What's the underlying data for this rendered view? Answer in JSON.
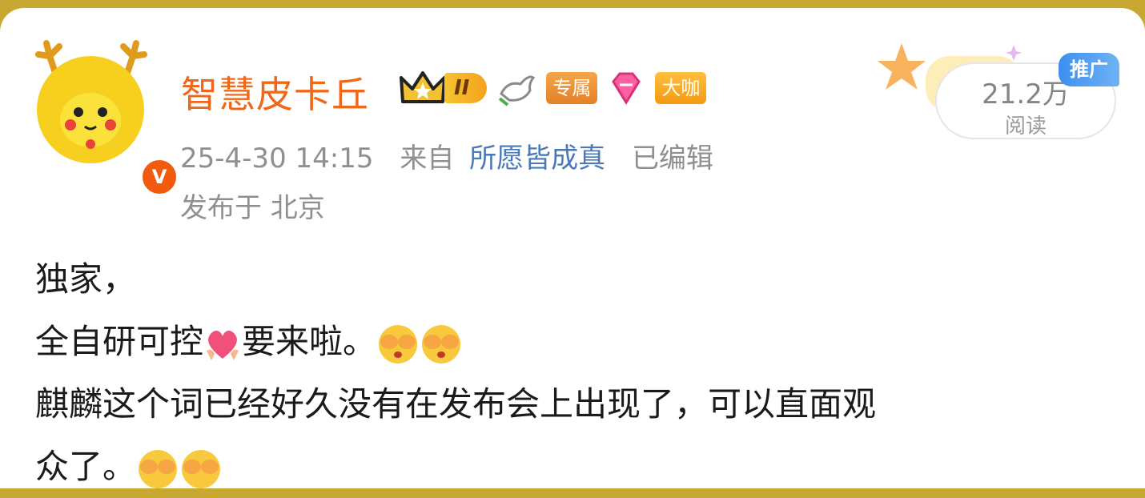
{
  "post": {
    "author": "智慧皮卡丘",
    "badges": {
      "level": "II",
      "exclusive": "专属",
      "vip": "大咖"
    },
    "time": "25-4-30 14:15",
    "from_label": "来自",
    "source": "所愿皆成真",
    "edited": "已编辑",
    "location": "发布于 北京",
    "reads_count": "21.2万",
    "reads_label": "阅读",
    "promo_label": "推广",
    "lines": [
      "独家，",
      "全自研可控",
      "要来啦。",
      "麒麟这个词已经好久没有在发布会上出现了，可以直面观",
      "众了。"
    ]
  },
  "icons": {
    "heart": "heart-icon",
    "cover_face": "see-no-evil-face-icon",
    "crown": "crown-icon",
    "dove": "dove-icon",
    "diamond": "diamond-icon",
    "verified": "verified-v-icon"
  },
  "colors": {
    "username": "#f0671a",
    "source_link": "#4a78b8",
    "meta": "#8f8f8f",
    "accent_top": "#c9a832"
  }
}
